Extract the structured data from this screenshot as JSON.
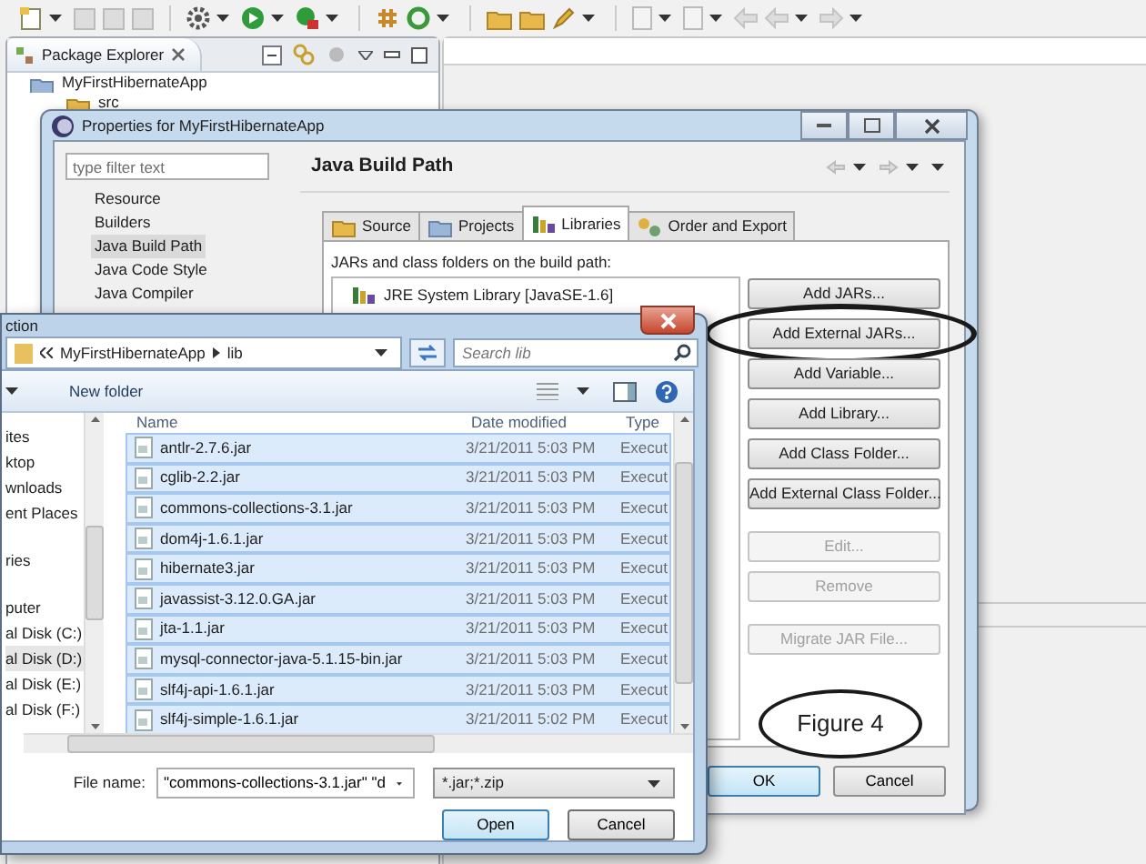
{
  "package_explorer": {
    "title": "Package Explorer",
    "tree": [
      {
        "label": "MyFirstHibernateApp",
        "children": [
          {
            "label": "src"
          }
        ]
      }
    ]
  },
  "properties_dialog": {
    "title": "Properties for MyFirstHibernateApp",
    "filter": {
      "placeholder": "type filter text"
    },
    "categories": [
      {
        "label": "Resource",
        "selected": false
      },
      {
        "label": "Builders",
        "selected": false
      },
      {
        "label": "Java Build Path",
        "selected": true
      },
      {
        "label": "Java Code Style",
        "selected": false
      },
      {
        "label": "Java Compiler",
        "selected": false
      }
    ],
    "page_title": "Java Build Path",
    "tabs": [
      {
        "label": "Source",
        "selected": false
      },
      {
        "label": "Projects",
        "selected": false
      },
      {
        "label": "Libraries",
        "selected": true
      },
      {
        "label": "Order and Export",
        "selected": false
      }
    ],
    "list_label": "JARs and class folders on the build path:",
    "libraries": [
      {
        "label": "JRE System Library [JavaSE-1.6]"
      }
    ],
    "button_groups": [
      {
        "buttons": [
          {
            "label": "Add JARs...",
            "disabled": false,
            "circled": false
          },
          {
            "label": "Add External JARs...",
            "disabled": false,
            "circled": true
          },
          {
            "label": "Add Variable...",
            "disabled": false,
            "circled": false
          },
          {
            "label": "Add Library...",
            "disabled": false,
            "circled": false
          },
          {
            "label": "Add Class Folder...",
            "disabled": false,
            "circled": false
          },
          {
            "label": "Add External Class Folder...",
            "disabled": false,
            "circled": false
          }
        ]
      },
      {
        "buttons": [
          {
            "label": "Edit...",
            "disabled": true,
            "circled": false
          },
          {
            "label": "Remove",
            "disabled": true,
            "circled": false
          }
        ]
      },
      {
        "buttons": [
          {
            "label": "Migrate JAR File...",
            "disabled": true,
            "circled": false
          }
        ]
      }
    ],
    "figure_label": "Figure 4",
    "footer_buttons": [
      {
        "label": "OK",
        "default": true
      },
      {
        "label": "Cancel",
        "default": false
      }
    ]
  },
  "file_dialog": {
    "title": "ction",
    "path": [
      "MyFirstHibernateApp",
      "lib"
    ],
    "search": {
      "placeholder": "Search lib"
    },
    "new_folder": "New folder",
    "nav_groups": [
      {
        "items": [
          {
            "label": "ites",
            "selected": false
          },
          {
            "label": "ktop",
            "selected": false
          },
          {
            "label": "wnloads",
            "selected": false
          },
          {
            "label": "ent Places",
            "selected": false
          }
        ]
      },
      {
        "items": [
          {
            "label": "ries",
            "selected": false
          }
        ]
      },
      {
        "items": [
          {
            "label": "puter",
            "selected": false
          },
          {
            "label": "al Disk (C:)",
            "selected": false
          },
          {
            "label": "al Disk (D:)",
            "selected": true
          },
          {
            "label": "al Disk (E:)",
            "selected": false
          },
          {
            "label": "al Disk (F:)",
            "selected": false
          }
        ]
      }
    ],
    "columns": [
      "Name",
      "Date modified",
      "Type"
    ],
    "rows": [
      {
        "name": "antlr-2.7.6.jar",
        "date": "3/21/2011 5:03 PM",
        "type": "Execut",
        "selected": true
      },
      {
        "name": "cglib-2.2.jar",
        "date": "3/21/2011 5:03 PM",
        "type": "Execut",
        "selected": true
      },
      {
        "name": "commons-collections-3.1.jar",
        "date": "3/21/2011 5:03 PM",
        "type": "Execut",
        "selected": true
      },
      {
        "name": "dom4j-1.6.1.jar",
        "date": "3/21/2011 5:03 PM",
        "type": "Execut",
        "selected": true
      },
      {
        "name": "hibernate3.jar",
        "date": "3/21/2011 5:03 PM",
        "type": "Execut",
        "selected": true
      },
      {
        "name": "javassist-3.12.0.GA.jar",
        "date": "3/21/2011 5:03 PM",
        "type": "Execut",
        "selected": true
      },
      {
        "name": "jta-1.1.jar",
        "date": "3/21/2011 5:03 PM",
        "type": "Execut",
        "selected": true
      },
      {
        "name": "mysql-connector-java-5.1.15-bin.jar",
        "date": "3/21/2011 5:03 PM",
        "type": "Execut",
        "selected": true
      },
      {
        "name": "slf4j-api-1.6.1.jar",
        "date": "3/21/2011 5:03 PM",
        "type": "Execut",
        "selected": true
      },
      {
        "name": "slf4j-simple-1.6.1.jar",
        "date": "3/21/2011 5:02 PM",
        "type": "Execut",
        "selected": true
      }
    ],
    "file_name_label": "File name:",
    "file_name": "\"commons-collections-3.1.jar\" \"d",
    "file_type": "*.jar;*.zip",
    "buttons": [
      {
        "label": "Open",
        "default": true
      },
      {
        "label": "Cancel",
        "default": false
      }
    ]
  }
}
